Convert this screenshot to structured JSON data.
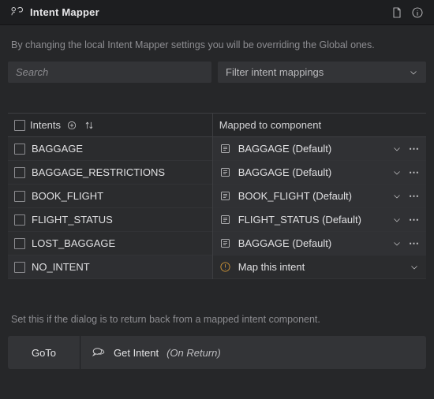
{
  "header": {
    "title": "Intent Mapper"
  },
  "info_text": "By changing the local Intent Mapper settings you will be overriding the Global ones.",
  "search": {
    "placeholder": "Search",
    "value": ""
  },
  "filter": {
    "label": "Filter intent mappings"
  },
  "columns": {
    "intents_label": "Intents",
    "mapped_label": "Mapped to component"
  },
  "rows": {
    "intents": [
      {
        "label": "BAGGAGE"
      },
      {
        "label": "BAGGAGE_RESTRICTIONS"
      },
      {
        "label": "BOOK_FLIGHT"
      },
      {
        "label": "FLIGHT_STATUS"
      },
      {
        "label": "LOST_BAGGAGE"
      },
      {
        "label": "NO_INTENT"
      }
    ],
    "mappings": [
      {
        "label": "BAGGAGE (Default)"
      },
      {
        "label": "BAGGAGE (Default)"
      },
      {
        "label": "BOOK_FLIGHT (Default)"
      },
      {
        "label": "FLIGHT_STATUS (Default)"
      },
      {
        "label": "BAGGAGE (Default)"
      },
      {
        "warn": true,
        "label": "Map this intent"
      }
    ]
  },
  "footer": {
    "info": "Set this if the dialog is to return back from a mapped intent component.",
    "goto_label": "GoTo",
    "get_intent_label": "Get Intent",
    "get_intent_sub": "(On Return)"
  }
}
